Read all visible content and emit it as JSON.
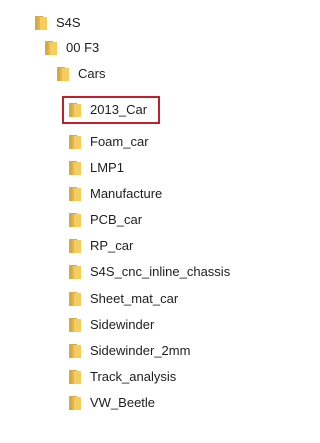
{
  "tree": {
    "nodes": [
      {
        "label": "S4S",
        "icon": "folder-icon"
      },
      {
        "label": "00 F3",
        "icon": "folder-icon"
      },
      {
        "label": "Cars",
        "icon": "folder-icon"
      },
      {
        "label": "2013_Car",
        "icon": "folder-icon",
        "highlighted": true
      },
      {
        "label": "Foam_car",
        "icon": "folder-icon"
      },
      {
        "label": "LMP1",
        "icon": "folder-icon"
      },
      {
        "label": "Manufacture",
        "icon": "folder-icon"
      },
      {
        "label": "PCB_car",
        "icon": "folder-icon"
      },
      {
        "label": "RP_car",
        "icon": "folder-icon"
      },
      {
        "label": "S4S_cnc_inline_chassis",
        "icon": "folder-icon"
      },
      {
        "label": "Sheet_mat_car",
        "icon": "folder-icon"
      },
      {
        "label": "Sidewinder",
        "icon": "folder-icon"
      },
      {
        "label": "Sidewinder_2mm",
        "icon": "folder-icon"
      },
      {
        "label": "Track_analysis",
        "icon": "folder-icon"
      },
      {
        "label": "VW_Beetle",
        "icon": "folder-icon"
      }
    ]
  },
  "colors": {
    "folder_back": "#d9a93a",
    "folder_front": "#f3cc62",
    "highlight_border": "#c0202a"
  }
}
